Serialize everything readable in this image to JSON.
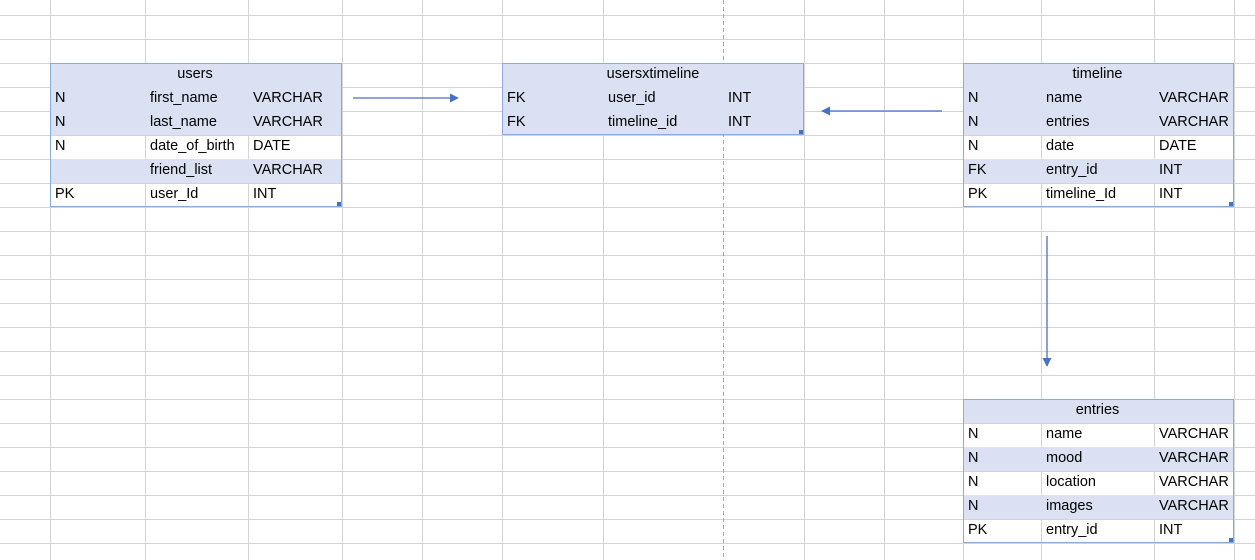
{
  "theme": {
    "header_fill": "#D9E1F2",
    "stripe_fill": "#D9E1F2",
    "table_border": "#8EA9DB",
    "gridline": "#D4D4D4",
    "arrow": "#4472C4"
  },
  "tables": [
    {
      "name": "users",
      "rows": [
        [
          "N",
          "first_name",
          "VARCHAR"
        ],
        [
          "N",
          "last_name",
          "VARCHAR"
        ],
        [
          "N",
          "date_of_birth",
          "DATE"
        ],
        [
          "",
          "friend_list",
          "VARCHAR"
        ],
        [
          "PK",
          "user_Id",
          "INT"
        ]
      ]
    },
    {
      "name": "usersxtimeline",
      "rows": [
        [
          "FK",
          "user_id",
          "INT"
        ],
        [
          "FK",
          "timeline_id",
          "INT"
        ]
      ]
    },
    {
      "name": "timeline",
      "rows": [
        [
          "N",
          "name",
          "VARCHAR"
        ],
        [
          "N",
          "entries",
          "VARCHAR"
        ],
        [
          "N",
          "date",
          "DATE"
        ],
        [
          "FK",
          "entry_id",
          "INT"
        ],
        [
          "PK",
          "timeline_Id",
          "INT"
        ]
      ]
    },
    {
      "name": "entries",
      "rows": [
        [
          "N",
          "name",
          "VARCHAR"
        ],
        [
          "N",
          "mood",
          "VARCHAR"
        ],
        [
          "N",
          "location",
          "VARCHAR"
        ],
        [
          "N",
          "images",
          "VARCHAR"
        ],
        [
          "PK",
          "entry_id",
          "INT"
        ]
      ]
    }
  ]
}
